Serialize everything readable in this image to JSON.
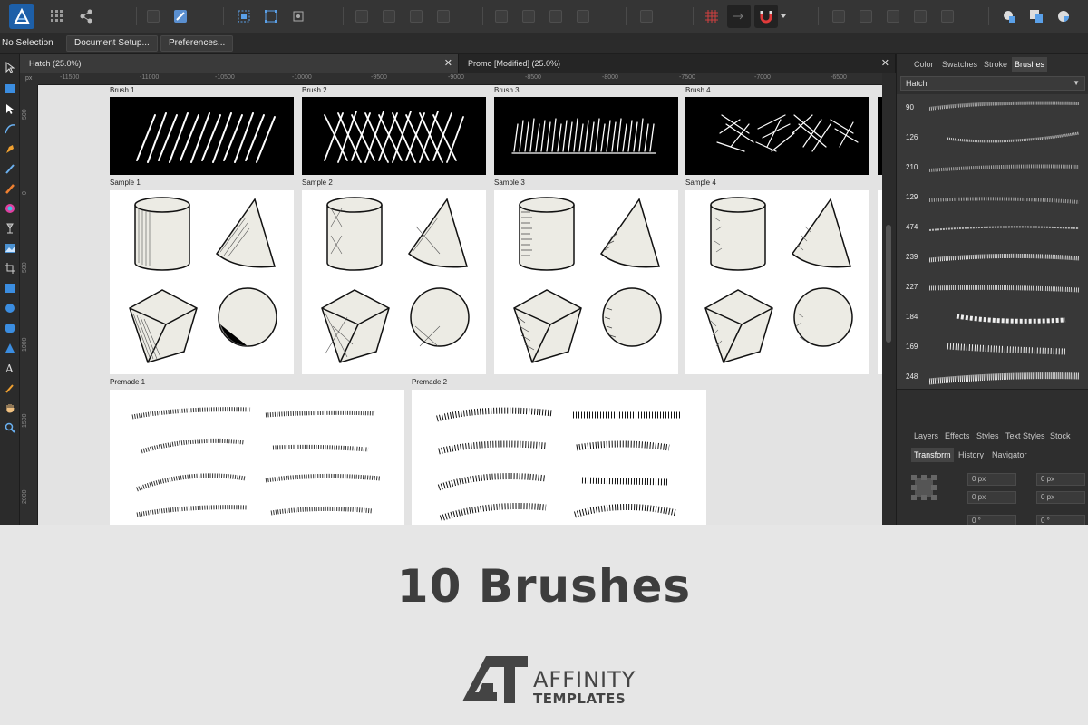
{
  "context_bar": {
    "selection_label": "No Selection",
    "document_setup_label": "Document Setup...",
    "preferences_label": "Preferences..."
  },
  "doc_tabs": [
    {
      "label": "Hatch (25.0%)",
      "active": true
    },
    {
      "label": "Promo [Modified] (25.0%)",
      "active": false
    }
  ],
  "doc_tab_close": "✕",
  "ruler": {
    "unit": "px",
    "h_ticks": [
      "-11500",
      "-11000",
      "-10500",
      "-10000",
      "-9500",
      "-9000",
      "-8500",
      "-8000",
      "-7500",
      "-7000",
      "-6500"
    ],
    "v_ticks": [
      "500",
      "0",
      "500",
      "1000",
      "1500",
      "2000"
    ]
  },
  "artboards": {
    "brush_labels": [
      "Brush 1",
      "Brush 2",
      "Brush 3",
      "Brush 4"
    ],
    "sample_labels": [
      "Sample 1",
      "Sample 2",
      "Sample 3",
      "Sample 4"
    ],
    "premade_labels": [
      "Premade 1",
      "Premade 2"
    ]
  },
  "right_panel": {
    "top_tabs": [
      "Color",
      "Swatches",
      "Stroke",
      "Brushes"
    ],
    "active_top_tab": "Brushes",
    "brush_category": "Hatch",
    "brush_sizes": [
      "90",
      "126",
      "210",
      "129",
      "474",
      "239",
      "227",
      "184",
      "169",
      "248"
    ],
    "middle_tabs": [
      "Layers",
      "Effects",
      "Styles",
      "Text Styles",
      "Stock"
    ],
    "bottom_tabs": [
      "Transform",
      "History",
      "Navigator"
    ],
    "active_bottom_tab": "Transform",
    "transform": {
      "x_value": "0 px",
      "y_value": "0 px",
      "w_value": "0 px",
      "h_value": "0 px",
      "r_value": "0 °",
      "s_value": "0 °"
    }
  },
  "footer": {
    "headline": "10 Brushes",
    "logo_word1": "AFFINITY",
    "logo_word2": "TEMPLATES"
  },
  "colors": {
    "app_bg": "#2e2e2e",
    "canvas_bg": "#e3e3e3",
    "page_bg": "#e6e6e6",
    "accent_blue": "#3b8de0",
    "headline": "#3d3d3d"
  }
}
